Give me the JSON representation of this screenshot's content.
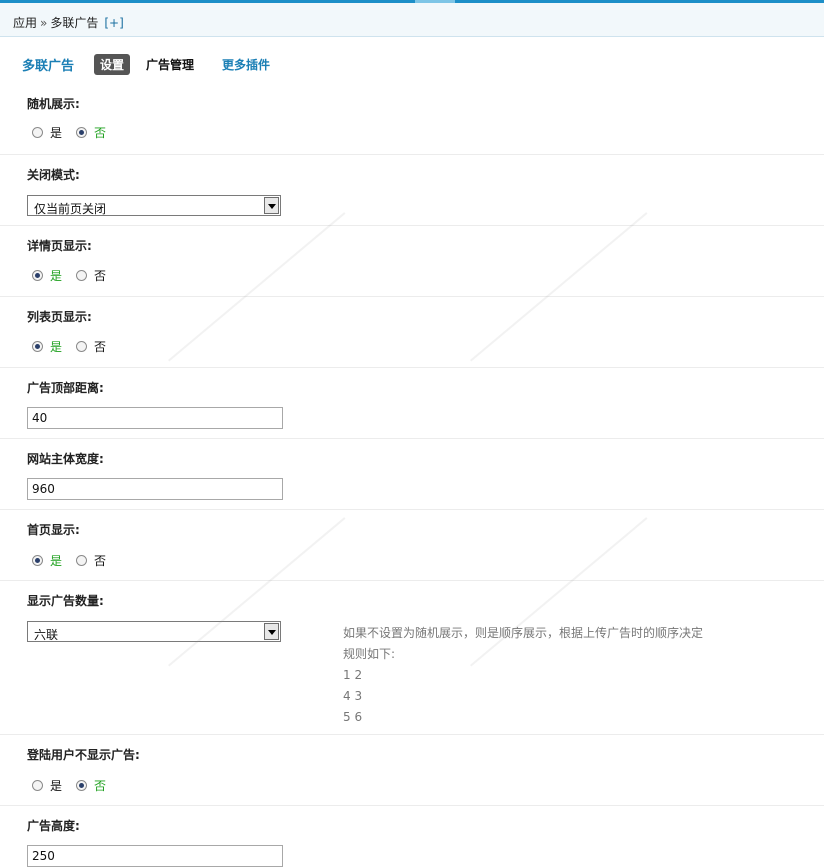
{
  "breadcrumb": {
    "root": "应用",
    "sep": "»",
    "current": "多联广告",
    "add": "[+]"
  },
  "nav": {
    "app_title": "多联广告",
    "tabs": [
      "设置",
      "广告管理"
    ],
    "more": "更多插件"
  },
  "fields": {
    "random": {
      "label": "随机展示:",
      "options": [
        "是",
        "否"
      ],
      "selected": "否"
    },
    "close_mode": {
      "label": "关闭模式:",
      "value": "仅当前页关闭"
    },
    "detail": {
      "label": "详情页显示:",
      "options": [
        "是",
        "否"
      ],
      "selected": "是"
    },
    "list": {
      "label": "列表页显示:",
      "options": [
        "是",
        "否"
      ],
      "selected": "是"
    },
    "top_distance": {
      "label": "广告顶部距离:",
      "value": "40"
    },
    "site_width": {
      "label": "网站主体宽度:",
      "value": "960"
    },
    "home": {
      "label": "首页显示:",
      "options": [
        "是",
        "否"
      ],
      "selected": "是"
    },
    "ad_count": {
      "label": "显示广告数量:",
      "value": "六联"
    },
    "logged_in": {
      "label": "登陆用户不显示广告:",
      "options": [
        "是",
        "否"
      ],
      "selected": "否"
    },
    "ad_height": {
      "label": "广告高度:",
      "value": "250"
    }
  },
  "hint": {
    "line1": "如果不设置为随机展示，则是顺序展示，根据上传广告时的顺序决定",
    "line2": "规则如下:",
    "line3": "1 2",
    "line4": "4 3",
    "line5": "5 6"
  }
}
